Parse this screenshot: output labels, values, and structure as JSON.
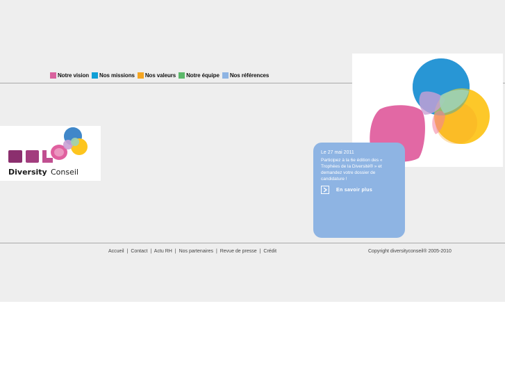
{
  "nav": {
    "items": [
      {
        "label": "Notre vision",
        "color": "#d9629e"
      },
      {
        "label": "Nos missions",
        "color": "#0f9fd6"
      },
      {
        "label": "Nos valeurs",
        "color": "#f5a623"
      },
      {
        "label": "Notre équipe",
        "color": "#5bb86a"
      },
      {
        "label": "Nos références",
        "color": "#8eb4e3"
      }
    ]
  },
  "logo": {
    "brand_bold": "Diversity",
    "brand_light": "Conseil"
  },
  "news": {
    "title": "Le 27 mai 2011",
    "body": "Participez à la 6e édition des « Trophées de la Diversité® » et demandez votre dossier de candidature !",
    "link": "En savoir plus",
    "background": "#8eb4e3"
  },
  "footer": {
    "links": [
      "Accueil",
      "Contact",
      "Actu RH",
      "Nos partenaires",
      "Revue de presse",
      "Crédit"
    ],
    "separator": "|",
    "copyright": "Copyright diversityconseil® 2005-2010"
  }
}
